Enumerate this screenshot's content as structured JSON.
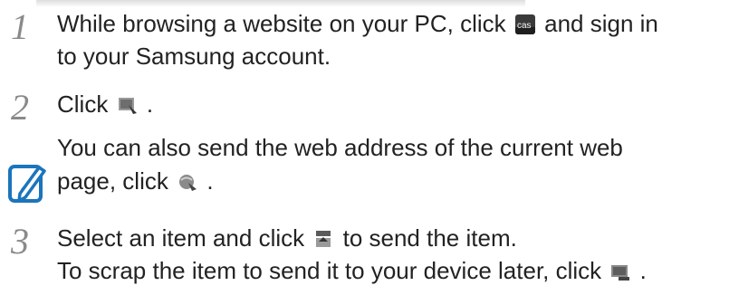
{
  "steps": [
    {
      "number": "1",
      "line1_before": "While browsing a website on your PC, click",
      "line1_icon": "cas-icon",
      "line1_after": "and sign in",
      "line2": "to your Samsung account."
    },
    {
      "number": "2",
      "before": "Click",
      "icon": "send-page-icon",
      "after": "."
    },
    {
      "number": "3",
      "line1_before": "Select an item and click",
      "line1_icon": "send-item-icon",
      "line1_after": "to send the item.",
      "line2_before": "To scrap the item to send it to your device later, click",
      "line2_icon": "scrap-icon",
      "line2_after": "."
    }
  ],
  "note": {
    "icon": "note-pen-icon",
    "line1": "You can also send the web address of the current web",
    "line2_before": "page, click",
    "line2_icon": "send-address-icon",
    "line2_after": "."
  },
  "colors": {
    "text": "#222222",
    "step_number": "#8a8a8a",
    "note_icon": "#1b75bc"
  }
}
